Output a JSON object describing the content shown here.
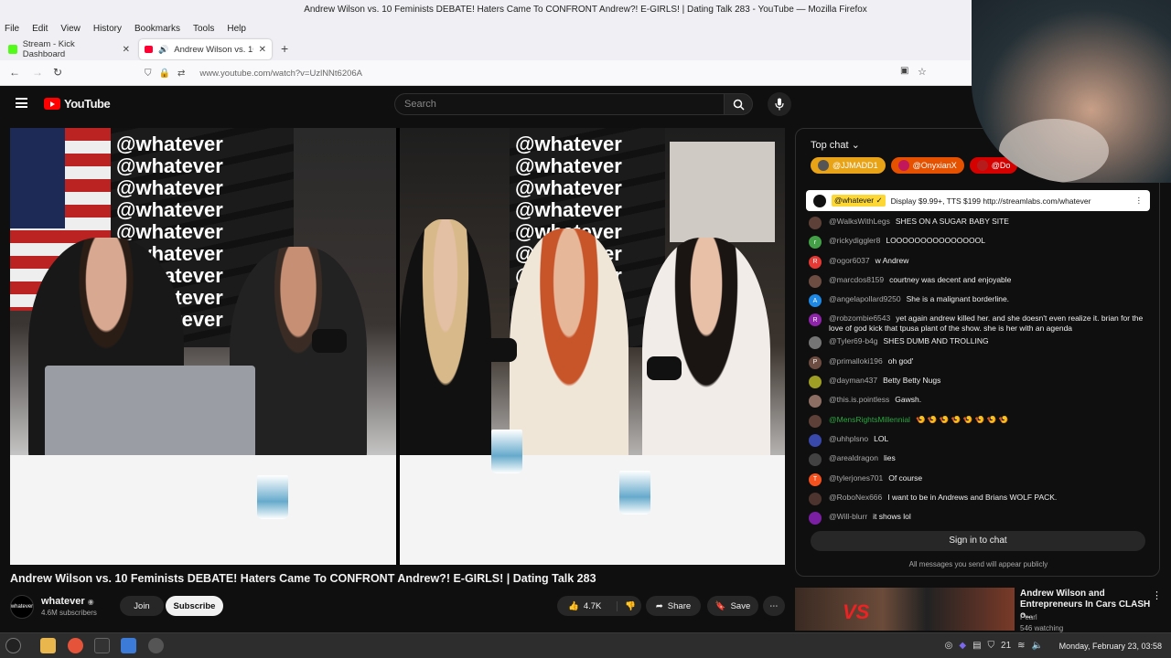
{
  "window": {
    "title": "Andrew Wilson vs. 10 Feminists DEBATE! Haters Came To CONFRONT Andrew?! E-GIRLS! | Dating Talk 283 - YouTube — Mozilla Firefox"
  },
  "menu": [
    "File",
    "Edit",
    "View",
    "History",
    "Bookmarks",
    "Tools",
    "Help"
  ],
  "tabs": [
    {
      "label": "Stream - Kick Dashboard",
      "icon": "kick-icon"
    },
    {
      "label": "Andrew Wilson vs. 10 Fe",
      "icon": "youtube-icon",
      "active": true
    }
  ],
  "url": "www.youtube.com/watch?v=UzlNNt6206A",
  "youtube": {
    "logo_text": "YouTube",
    "search_placeholder": "Search",
    "video_overlay_text": "@whatever",
    "video_title": "Andrew Wilson vs. 10 Feminists DEBATE! Haters Came To CONFRONT Andrew?! E-GIRLS! | Dating Talk 283",
    "channel": {
      "name": "whatever",
      "subscribers": "4.6M subscribers",
      "avatar_text": "whatever"
    },
    "buttons": {
      "join": "Join",
      "subscribe": "Subscribe",
      "likes": "4.7K",
      "share": "Share",
      "save": "Save",
      "more": "⋯"
    }
  },
  "chat": {
    "header": "Top chat",
    "tickers": [
      {
        "name": "@JJMADD1",
        "color": "#e8a317"
      },
      {
        "name": "@OnyxianX",
        "color": "#e65100"
      },
      {
        "name": "@Do",
        "color": "#d50000"
      }
    ],
    "pinned": {
      "author": "@whatever ✓",
      "text": "Display $9.99+, TTS $199 http://streamlabs.com/whatever"
    },
    "messages": [
      {
        "author": "@WalksWithLegs",
        "text": "SHES ON A SUGAR BABY SITE",
        "avatar_color": "#5d4037",
        "initial": ""
      },
      {
        "author": "@rickydiggler8",
        "text": "LOOOOOOOOOOOOOOOL",
        "avatar_color": "#43a047",
        "initial": "r"
      },
      {
        "author": "@ogor6037",
        "text": "w Andrew",
        "avatar_color": "#e53935",
        "initial": "R"
      },
      {
        "author": "@marcdos8159",
        "text": "courtney was decent and enjoyable",
        "avatar_color": "#6d4c41",
        "initial": ""
      },
      {
        "author": "@angelapollard9250",
        "text": "She is a malignant borderline.",
        "avatar_color": "#1e88e5",
        "initial": "A"
      },
      {
        "author": "@robzombie6543",
        "text": "yet again andrew killed her. and she doesn't even realize it. brian for the love of god kick that tpusa plant of the show. she is her with an agenda",
        "avatar_color": "#8e24aa",
        "initial": "R"
      },
      {
        "author": "@Tyler69-b4g",
        "text": "SHES DUMB AND TROLLING",
        "avatar_color": "#757575",
        "initial": ""
      },
      {
        "author": "@primalloki196",
        "text": "oh god'",
        "avatar_color": "#6d4c41",
        "initial": "P"
      },
      {
        "author": "@dayman437",
        "text": "Betty Betty Nugs",
        "avatar_color": "#9e9d24",
        "initial": ""
      },
      {
        "author": "@this.is.pointless",
        "text": "Gawsh.",
        "avatar_color": "#8d6e63",
        "initial": ""
      },
      {
        "author": "@MensRightsMillennial",
        "text": "🍤 🍤 🍤 🍤 🍤 🍤 🍤 🍤",
        "avatar_color": "#5d4037",
        "initial": "",
        "member": true
      },
      {
        "author": "@uhhplsno",
        "text": "LOL",
        "avatar_color": "#3949ab",
        "initial": ""
      },
      {
        "author": "@arealdragon",
        "text": "lies",
        "avatar_color": "#424242",
        "initial": ""
      },
      {
        "author": "@tylerjones701",
        "text": "Of course",
        "avatar_color": "#f4511e",
        "initial": "T"
      },
      {
        "author": "@RoboNex666",
        "text": "I want to be in Andrews and Brians WOLF PACK.",
        "avatar_color": "#4e342e",
        "initial": ""
      },
      {
        "author": "@Will-blurr",
        "text": "it shows lol",
        "avatar_color": "#7b1fa2",
        "initial": ""
      }
    ],
    "sign_in": "Sign in to chat",
    "note": "All messages you send will appear publicly"
  },
  "recommendation": {
    "title": "Andrew Wilson and Entrepreneurs In Cars CLASH o...",
    "channel": "Pearl",
    "views": "546 watching",
    "thumb_text": "VS"
  },
  "taskbar": {
    "tray_number": "21",
    "clock": "Monday, February 23, 03:58"
  }
}
